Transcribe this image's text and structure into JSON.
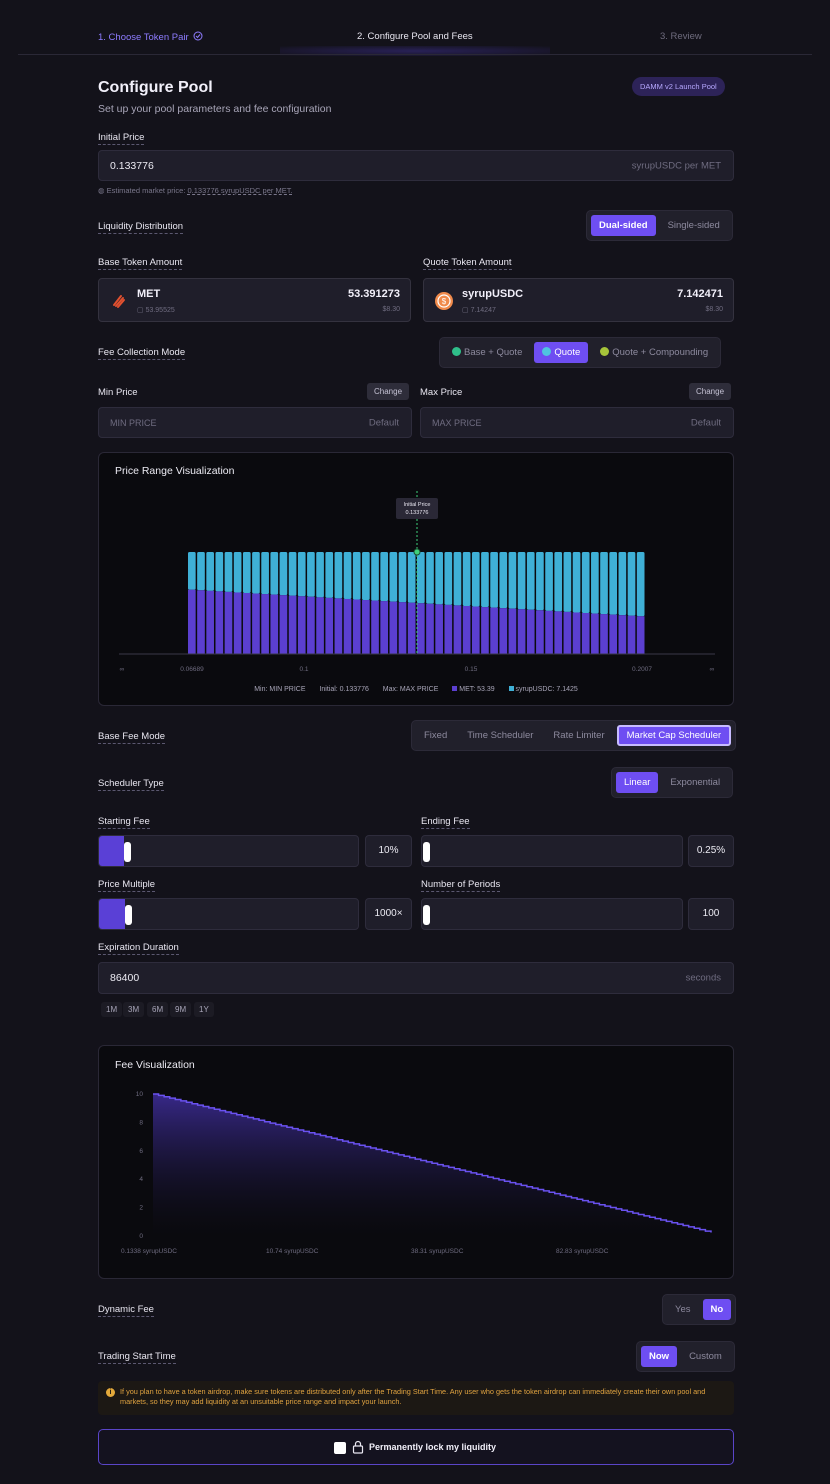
{
  "stepper": {
    "step1": "1. Choose Token Pair",
    "step2": "2. Configure Pool and Fees",
    "step3": "3. Review"
  },
  "header": {
    "title": "Configure Pool",
    "subtitle": "Set up your pool parameters and fee configuration",
    "badge": "DAMM v2 Launch Pool"
  },
  "initial_price": {
    "label": "Initial Price",
    "value": "0.133776",
    "unit": "syrupUSDC per MET",
    "hint_prefix": "Estimated market price: ",
    "hint_value": "0.133776 syrupUSDC per MET."
  },
  "liquidity": {
    "label": "Liquidity Distribution",
    "options": [
      "Dual-sided",
      "Single-sided"
    ],
    "selected": "Dual-sided"
  },
  "base_token": {
    "label": "Base Token Amount",
    "name": "MET",
    "balance": "53.95525",
    "amount": "53.391273",
    "usd": "$8.30"
  },
  "quote_token": {
    "label": "Quote Token Amount",
    "name": "syrupUSDC",
    "balance": "7.14247",
    "amount": "7.142471",
    "usd": "$8.30"
  },
  "fee_collection": {
    "label": "Fee Collection Mode",
    "options": [
      "Base + Quote",
      "Quote",
      "Quote + Compounding"
    ],
    "selected": "Quote"
  },
  "min_price": {
    "label": "Min Price",
    "change": "Change",
    "placeholder": "MIN PRICE",
    "default": "Default"
  },
  "max_price": {
    "label": "Max Price",
    "change": "Change",
    "placeholder": "MAX PRICE",
    "default": "Default"
  },
  "price_viz": {
    "title": "Price Range Visualization",
    "tooltip_title": "Initial Price",
    "tooltip_value": "0.133776",
    "x_ticks": [
      "∞",
      "0.06689",
      "0.1",
      "0.15",
      "0.2007",
      "∞"
    ],
    "legend": {
      "min": "Min: MIN PRICE",
      "initial": "Initial: 0.133776",
      "max": "Max: MAX PRICE",
      "met": "MET: 53.39",
      "usdc": "syrupUSDC: 7.1425"
    },
    "colors": {
      "base": "#5b3fd0",
      "quote": "#3fb0d6",
      "marker": "#3fd07a"
    }
  },
  "chart_data": [
    {
      "type": "bar",
      "title": "Price Range Visualization",
      "description_series": [
        "MET",
        "syrupUSDC"
      ],
      "x_ticks": [
        "0.06689",
        "0.1",
        "0.15",
        "0.2007"
      ],
      "bar_count": 50,
      "initial_price": 0.133776,
      "totals": {
        "MET": 53.39,
        "syrupUSDC": 7.1425
      },
      "base_fraction_start": 0.63,
      "base_fraction_end": 0.37
    },
    {
      "type": "line",
      "title": "Fee Visualization",
      "y_ticks": [
        0,
        2,
        4,
        6,
        8,
        10
      ],
      "x_ticks": [
        "0.1338 syrupUSDC",
        "10.74 syrupUSDC",
        "38.31 syrupUSDC",
        "82.83 syrupUSDC"
      ],
      "x": [
        0,
        100
      ],
      "y": [
        10,
        0.25
      ],
      "ylim": [
        0,
        10
      ]
    }
  ],
  "base_fee_mode": {
    "label": "Base Fee Mode",
    "options": [
      "Fixed",
      "Time Scheduler",
      "Rate Limiter",
      "Market Cap Scheduler"
    ],
    "selected": "Market Cap Scheduler"
  },
  "scheduler_type": {
    "label": "Scheduler Type",
    "options": [
      "Linear",
      "Exponential"
    ],
    "selected": "Linear"
  },
  "starting_fee": {
    "label": "Starting Fee",
    "value": "10%",
    "fraction": 0.1
  },
  "ending_fee": {
    "label": "Ending Fee",
    "value": "0.25%",
    "fraction": 0.0
  },
  "price_multiple": {
    "label": "Price Multiple",
    "value": "1000×",
    "fraction": 0.1
  },
  "number_of_periods": {
    "label": "Number of Periods",
    "value": "100",
    "fraction": 0.0
  },
  "expiration": {
    "label": "Expiration Duration",
    "value": "86400",
    "unit": "seconds",
    "presets": [
      "1M",
      "3M",
      "6M",
      "9M",
      "1Y"
    ]
  },
  "fee_viz": {
    "title": "Fee Visualization"
  },
  "dynamic_fee": {
    "label": "Dynamic Fee",
    "options": [
      "Yes",
      "No"
    ],
    "selected": "No"
  },
  "trading_start": {
    "label": "Trading Start Time",
    "options": [
      "Now",
      "Custom"
    ],
    "selected": "Now"
  },
  "warning": {
    "text": "If you plan to have a token airdrop, make sure tokens are distributed only after the Trading Start Time. Any user who gets the token airdrop can immediately create their own pool and markets, so they may add liquidity at an unsuitable price range and impact your launch."
  },
  "lock": {
    "label": "Permanently lock my liquidity"
  }
}
